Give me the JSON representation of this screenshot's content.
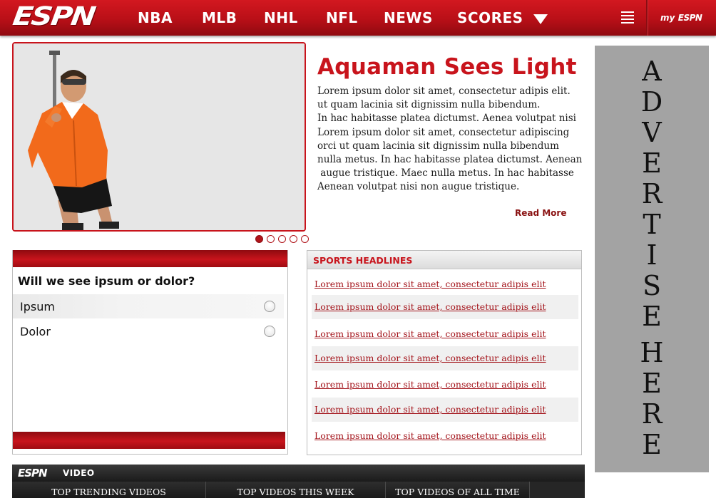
{
  "header": {
    "logo": "ESPN",
    "nav": [
      "NBA",
      "MLB",
      "NHL",
      "NFL",
      "NEWS",
      "SCORES"
    ],
    "my_prefix": "my",
    "my_brand": "ESPN"
  },
  "hero": {
    "title": "Aquaman Sees Light",
    "body_lines": [
      "Lorem ipsum dolor sit amet, consectetur adipis elit.",
      "ut quam lacinia sit dignissim nulla bibendum.",
      "In hac habitasse platea dictumst. Aenea volutpat nisi",
      "Lorem ipsum dolor sit amet, consectetur adipiscing",
      "orci ut quam lacinia sit dignissim nulla bibendum",
      "nulla metus. In hac habitasse platea dictumst. Aenean",
      " augue tristique. Maec nulla metus. In hac habitasse",
      "Aenean volutpat nisi non augue tristique."
    ],
    "read_more": "Read More",
    "slides_total": 5,
    "slide_active": 1
  },
  "poll": {
    "question": "Will we see ipsum or dolor?",
    "options": [
      "Ipsum",
      "Dolor"
    ]
  },
  "headlines": {
    "title": "SPORTS HEADLINES",
    "items": [
      "Lorem ipsum dolor sit amet, consectetur adipis elit",
      "Lorem ipsum dolor sit amet, consectetur adipis elit",
      "Lorem ipsum dolor sit amet, consectetur adipis elit",
      "Lorem ipsum dolor sit amet, consectetur adipis elit",
      "Lorem ipsum dolor sit amet, consectetur adipis elit",
      "Lorem ipsum dolor sit amet, consectetur adipis elit",
      "Lorem ipsum dolor sit amet, consectetur adipis elit"
    ]
  },
  "ad": {
    "word1": "ADVERTISE",
    "word2": "HERE"
  },
  "video": {
    "brand": "ESPN",
    "label": "VIDEO",
    "tabs": [
      "TOP TRENDING VIDEOS",
      "TOP VIDEOS THIS WEEK",
      "TOP VIDEOS OF ALL TIME"
    ]
  },
  "colors": {
    "brand_red": "#c8141c",
    "ad_gray": "#a3a3a3",
    "link_red": "#a3131a"
  }
}
